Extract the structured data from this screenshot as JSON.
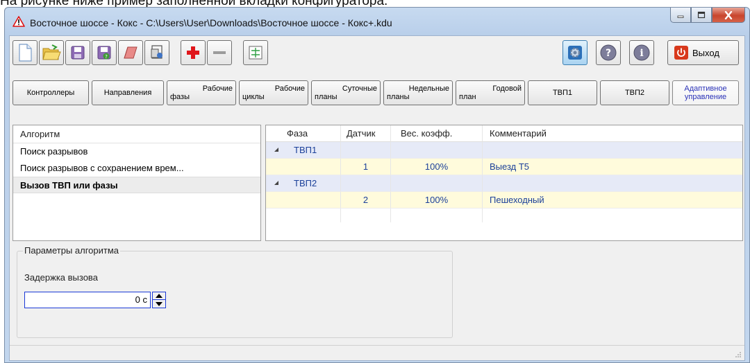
{
  "caption": "На рисунке ниже пример заполненной вкладки конфигуратора.",
  "window": {
    "title": "Восточное шоссе - Кокс - C:\\Users\\User\\Downloads\\Восточное шоссе - Кокс+.kdu"
  },
  "toolbar": {
    "icons": [
      "new-document-icon",
      "open-folder-icon",
      "save-icon",
      "save-as-icon",
      "eraser-icon",
      "properties-icon",
      "add-icon",
      "remove-icon",
      "layout-icon",
      "settings-icon",
      "help-icon",
      "info-icon",
      "power-icon"
    ],
    "exit_label": "Выход"
  },
  "nav": {
    "controllers": "Контроллеры",
    "directions": "Направления",
    "work_phases_1": "Рабочие",
    "work_phases_2": "фазы",
    "work_cycles_1": "Рабочие",
    "work_cycles_2": "циклы",
    "daily_plans_1": "Суточные",
    "daily_plans_2": "планы",
    "weekly_plans_1": "Недельные",
    "weekly_plans_2": "планы",
    "annual_plan_1": "Годовой",
    "annual_plan_2": "план",
    "tvp1": "ТВП1",
    "tvp2": "ТВП2",
    "adaptive_1": "Адаптивное",
    "adaptive_2": "управление"
  },
  "algorithms": {
    "header": "Алгоритм",
    "items": [
      {
        "label": "Поиск разрывов"
      },
      {
        "label": "Поиск разрывов с сохранением врем..."
      },
      {
        "label": "Вызов ТВП или фазы"
      }
    ],
    "selected_index": 2
  },
  "grid": {
    "columns": [
      "Фаза",
      "Датчик",
      "Вес. коэфф.",
      "Комментарий"
    ],
    "groups": [
      {
        "name": "ТВП1",
        "rows": [
          {
            "sensor": "1",
            "weight": "100%",
            "comment": "Выезд Т5"
          }
        ]
      },
      {
        "name": "ТВП2",
        "rows": [
          {
            "sensor": "2",
            "weight": "100%",
            "comment": "Пешеходный"
          }
        ]
      }
    ]
  },
  "params": {
    "legend": "Параметры алгоритма",
    "delay_label": "Задержка вызова",
    "delay_value": "0 с"
  },
  "colors": {
    "accent_blue": "#1a39d6",
    "group_row": "#e6eaf7",
    "data_row": "#fffbdc",
    "active_nav_text": "#2a32b8"
  }
}
